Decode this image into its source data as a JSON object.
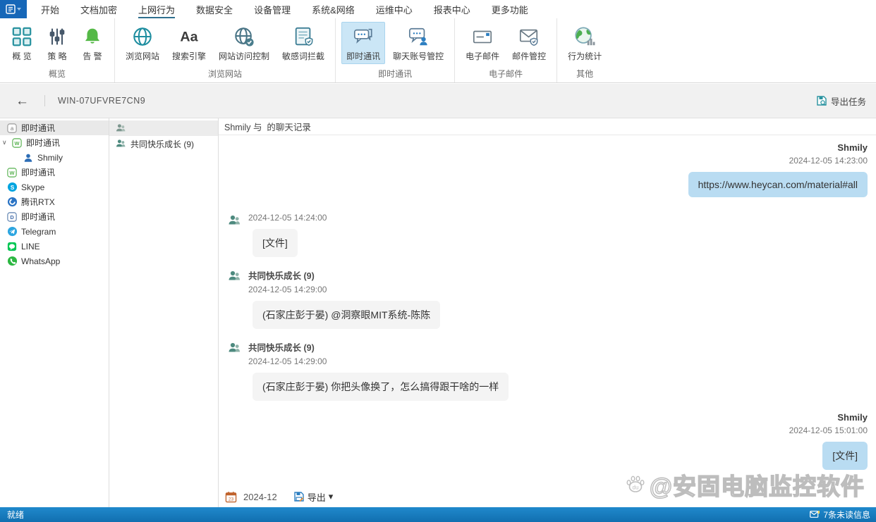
{
  "colors": {
    "accent_blue": "#1667b8",
    "highlight_blue": "#cbe6f6",
    "bubble_blue": "#b9dcf2",
    "bubble_grey": "#f4f4f4",
    "statusbar_blue": "#1779bd",
    "tab_underline": "#2f6f8f"
  },
  "tabs": [
    {
      "label": "开始"
    },
    {
      "label": "文档加密"
    },
    {
      "label": "上网行为",
      "active": true
    },
    {
      "label": "数据安全"
    },
    {
      "label": "设备管理"
    },
    {
      "label": "系统&网络"
    },
    {
      "label": "运维中心"
    },
    {
      "label": "报表中心"
    },
    {
      "label": "更多功能"
    }
  ],
  "ribbon": {
    "groups": [
      {
        "label": "概览",
        "buttons": [
          {
            "label": "概 览",
            "icon": "grid-icon"
          },
          {
            "label": "策 略",
            "icon": "sliders-icon"
          },
          {
            "label": "告 警",
            "icon": "bell-icon"
          }
        ]
      },
      {
        "label": "浏览网站",
        "buttons": [
          {
            "label": "浏览网站",
            "icon": "globe-icon"
          },
          {
            "label": "搜索引擎",
            "icon": "font-icon"
          },
          {
            "label": "网站访问控制",
            "icon": "globe-check-icon"
          },
          {
            "label": "敏感词拦截",
            "icon": "doc-shield-icon"
          }
        ]
      },
      {
        "label": "即时通讯",
        "buttons": [
          {
            "label": "即时通讯",
            "icon": "chat-icon",
            "active": true
          },
          {
            "label": "聊天账号管控",
            "icon": "chat-user-icon"
          }
        ]
      },
      {
        "label": "电子邮件",
        "buttons": [
          {
            "label": "电子邮件",
            "icon": "mail-icon"
          },
          {
            "label": "邮件管控",
            "icon": "mail-shield-icon"
          }
        ]
      },
      {
        "label": "其他",
        "buttons": [
          {
            "label": "行为统计",
            "icon": "globe-stats-icon"
          }
        ]
      }
    ]
  },
  "toolbar": {
    "back": "←",
    "device": "WIN-07UFVRE7CN9",
    "export_task": "导出任务"
  },
  "sidebar": {
    "items": [
      {
        "label": "即时通讯",
        "icon": "im-all-icon",
        "selected": true
      },
      {
        "label": "即时通讯",
        "icon": "wechat-icon",
        "expanded": true,
        "expander": "∨"
      },
      {
        "label": "Shmily",
        "icon": "user-blue-icon",
        "child": true
      },
      {
        "label": "即时通讯",
        "icon": "wechat-icon"
      },
      {
        "label": "Skype",
        "icon": "skype-icon"
      },
      {
        "label": "腾讯RTX",
        "icon": "rtx-icon"
      },
      {
        "label": "即时通讯",
        "icon": "dingtalk-icon"
      },
      {
        "label": "Telegram",
        "icon": "telegram-icon"
      },
      {
        "label": "LINE",
        "icon": "line-icon"
      },
      {
        "label": "WhatsApp",
        "icon": "whatsapp-icon"
      }
    ]
  },
  "contacts": {
    "header_icon": "group-icon",
    "rows": [
      {
        "label": "共同快乐成长 (9)",
        "icon": "group-icon"
      }
    ]
  },
  "chat": {
    "title": "Shmily 与  的聊天记录",
    "messages": [
      {
        "side": "right",
        "name": "Shmily",
        "time": "2024-12-05 14:23:00",
        "text": "https://www.heycan.com/material#all"
      },
      {
        "side": "left",
        "name": "",
        "time": "2024-12-05 14:24:00",
        "text": "[文件]"
      },
      {
        "side": "left",
        "name": "共同快乐成长 (9)",
        "time": "2024-12-05 14:29:00",
        "text": "(石家庄彭于晏) @洞察眼MIT系统-陈陈"
      },
      {
        "side": "left",
        "name": "共同快乐成长 (9)",
        "time": "2024-12-05 14:29:00",
        "text": "(石家庄彭于晏) 你把头像换了，怎么搞得跟干啥的一样"
      },
      {
        "side": "right",
        "name": "Shmily",
        "time": "2024-12-05 15:01:00",
        "text": "[文件]"
      }
    ],
    "footer": {
      "month": "2024-12",
      "export_label": "导出",
      "caret": "▾"
    }
  },
  "watermark": {
    "text": "@安固电脑监控软件",
    "logo": "paw-du-icon"
  },
  "statusbar": {
    "left": "就绪",
    "right": "7条未读信息"
  }
}
